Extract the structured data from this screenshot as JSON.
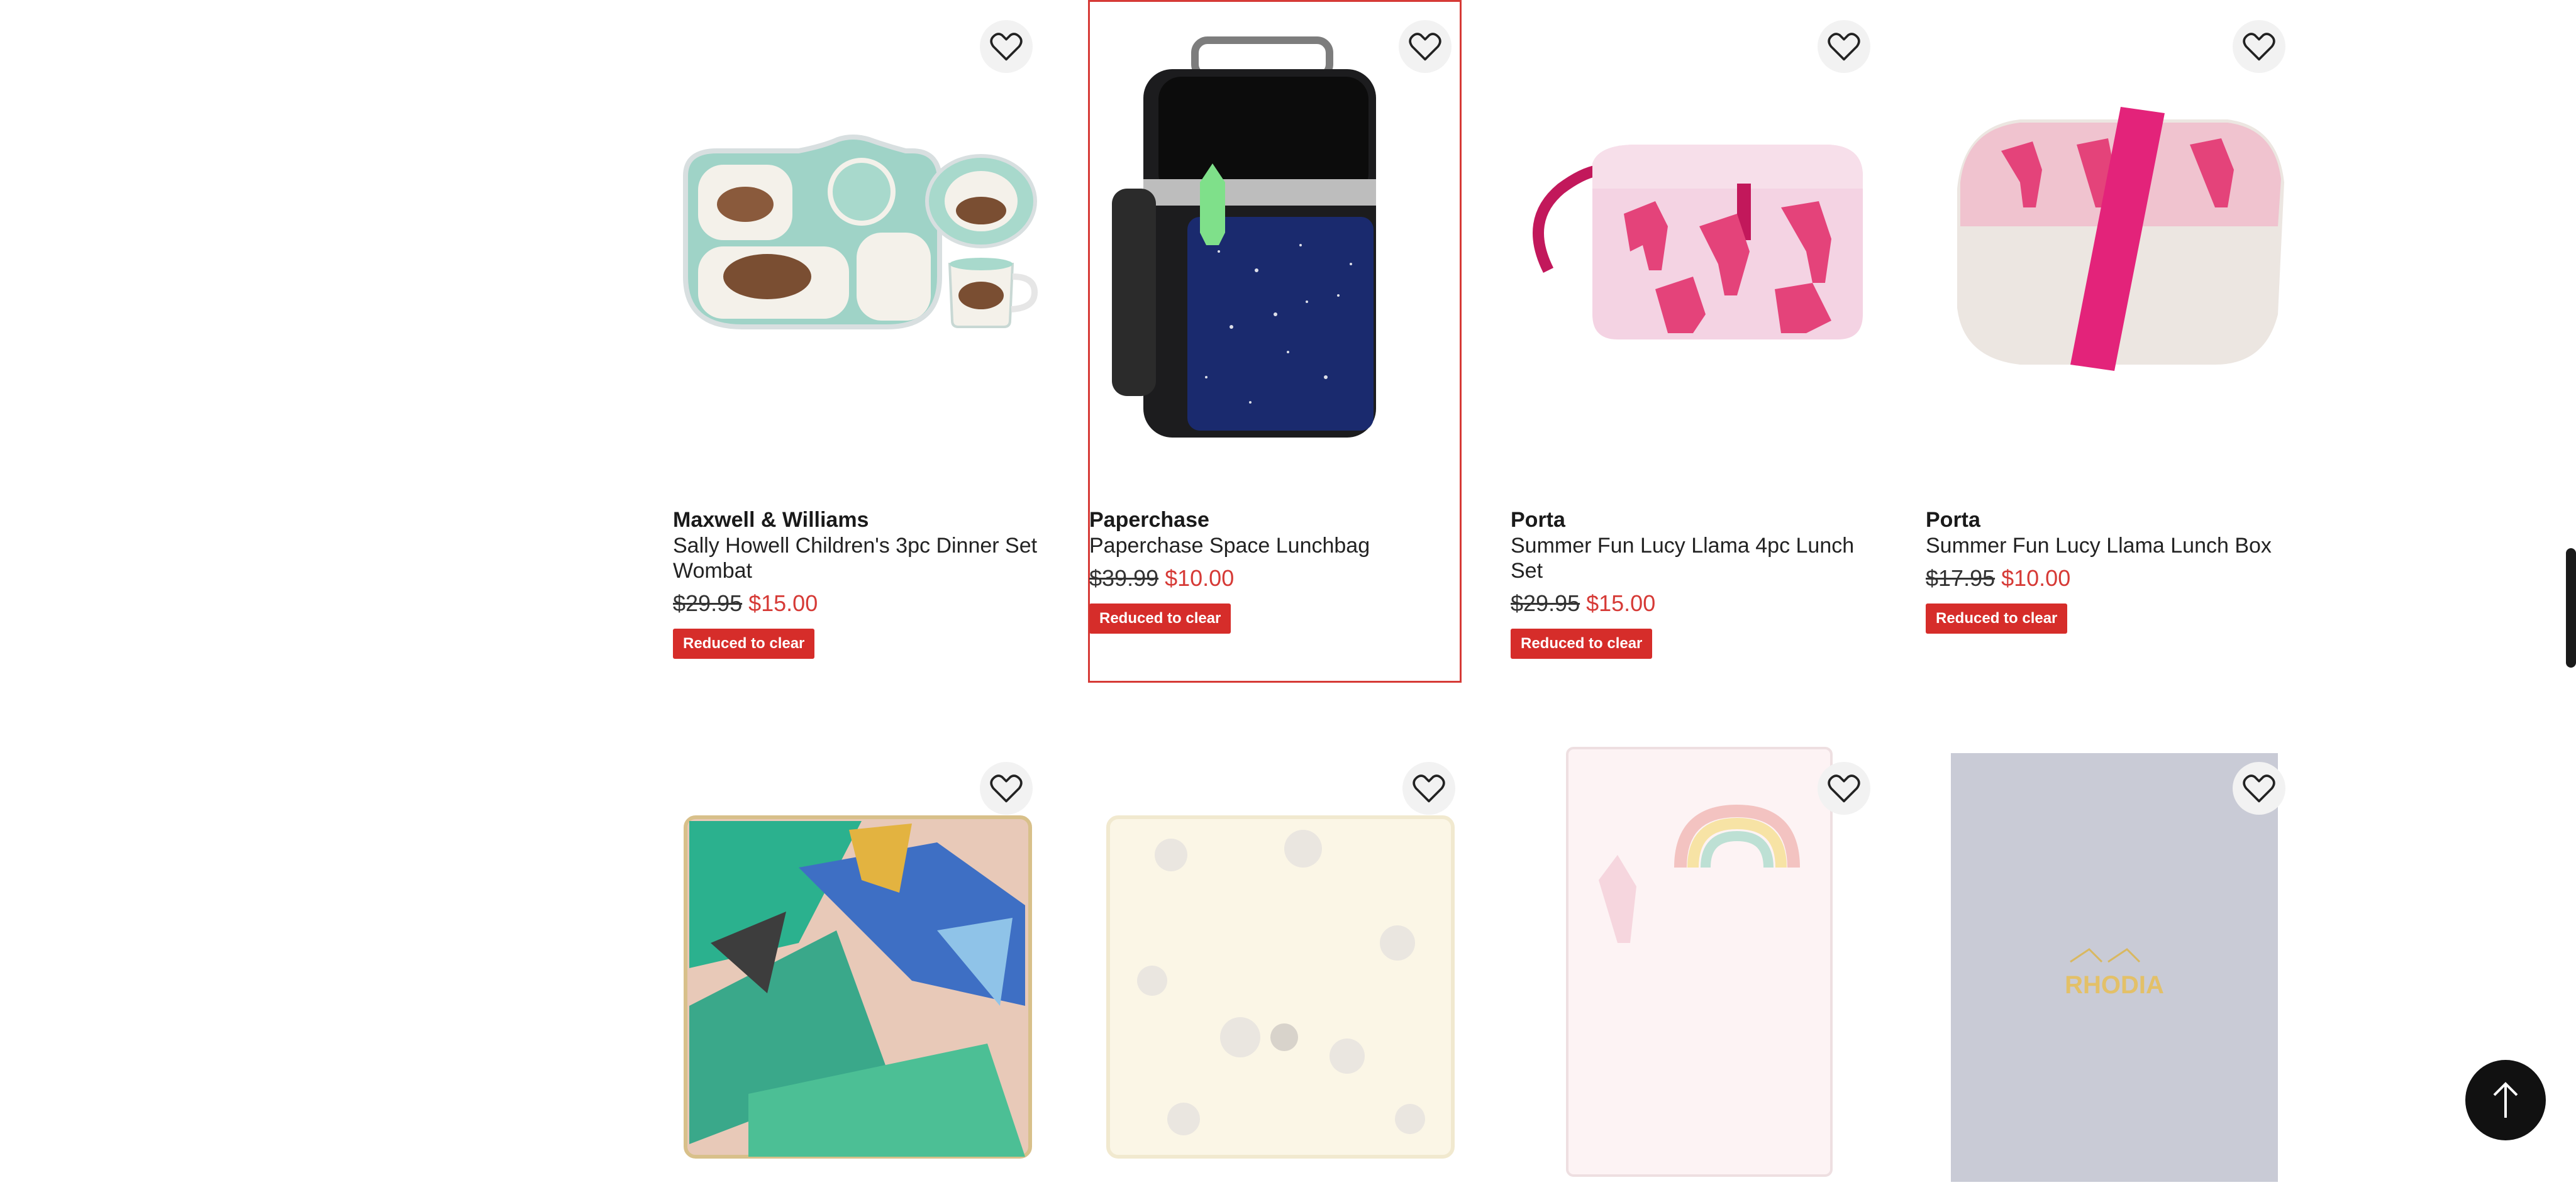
{
  "products": [
    {
      "brand": "Maxwell & Williams",
      "name": "Sally Howell Children's 3pc Dinner Set Wombat",
      "was": "$29.95",
      "now": "$15.00",
      "badge": "Reduced to clear"
    },
    {
      "brand": "Paperchase",
      "name": "Paperchase Space Lunchbag",
      "was": "$39.99",
      "now": "$10.00",
      "badge": "Reduced to clear"
    },
    {
      "brand": "Porta",
      "name": "Summer Fun Lucy Llama 4pc Lunch Set",
      "was": "$29.95",
      "now": "$15.00",
      "badge": "Reduced to clear"
    },
    {
      "brand": "Porta",
      "name": "Summer Fun Lucy Llama Lunch Box",
      "was": "$17.95",
      "now": "$10.00",
      "badge": "Reduced to clear"
    }
  ],
  "row2_image_text": {
    "rhodia": "RHODIA"
  },
  "icons": {
    "wishlist": "heart-outline-icon",
    "back_to_top": "arrow-up-icon"
  },
  "colors": {
    "sale_red": "#d62d2a",
    "highlight_border": "#d63a36",
    "back_to_top_bg": "#111111"
  }
}
